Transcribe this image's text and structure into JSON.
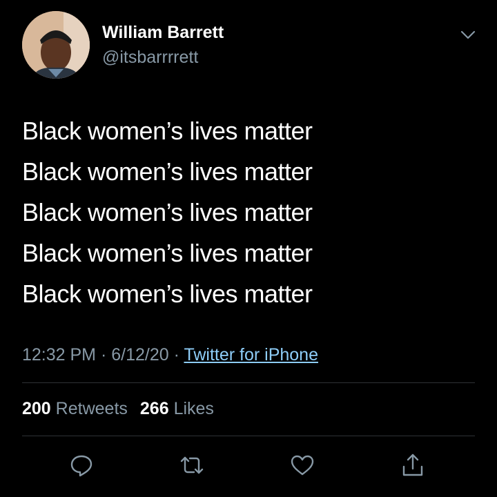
{
  "tweet": {
    "author": {
      "display_name": "William Barrett",
      "handle": "@itsbarrrrett",
      "avatar_icon": "profile-photo"
    },
    "menu_icon": "chevron-down-icon",
    "body_lines": [
      "Black women’s lives matter",
      "Black women’s lives matter",
      "Black women’s lives matter",
      "Black women’s lives matter",
      "Black women’s lives matter"
    ],
    "meta": {
      "time": "12:32 PM",
      "separator": "·",
      "date": "6/12/20",
      "source": "Twitter for iPhone"
    },
    "stats": {
      "retweets_count": "200",
      "retweets_label": "Retweets",
      "likes_count": "266",
      "likes_label": "Likes"
    },
    "actions": [
      {
        "icon": "reply-icon"
      },
      {
        "icon": "retweet-icon"
      },
      {
        "icon": "like-heart-icon"
      },
      {
        "icon": "share-icon"
      }
    ],
    "colors": {
      "background": "#000000",
      "text": "#ffffff",
      "secondary_text": "#8899a6",
      "link": "#8ecdf8",
      "divider": "#2f3336"
    }
  }
}
